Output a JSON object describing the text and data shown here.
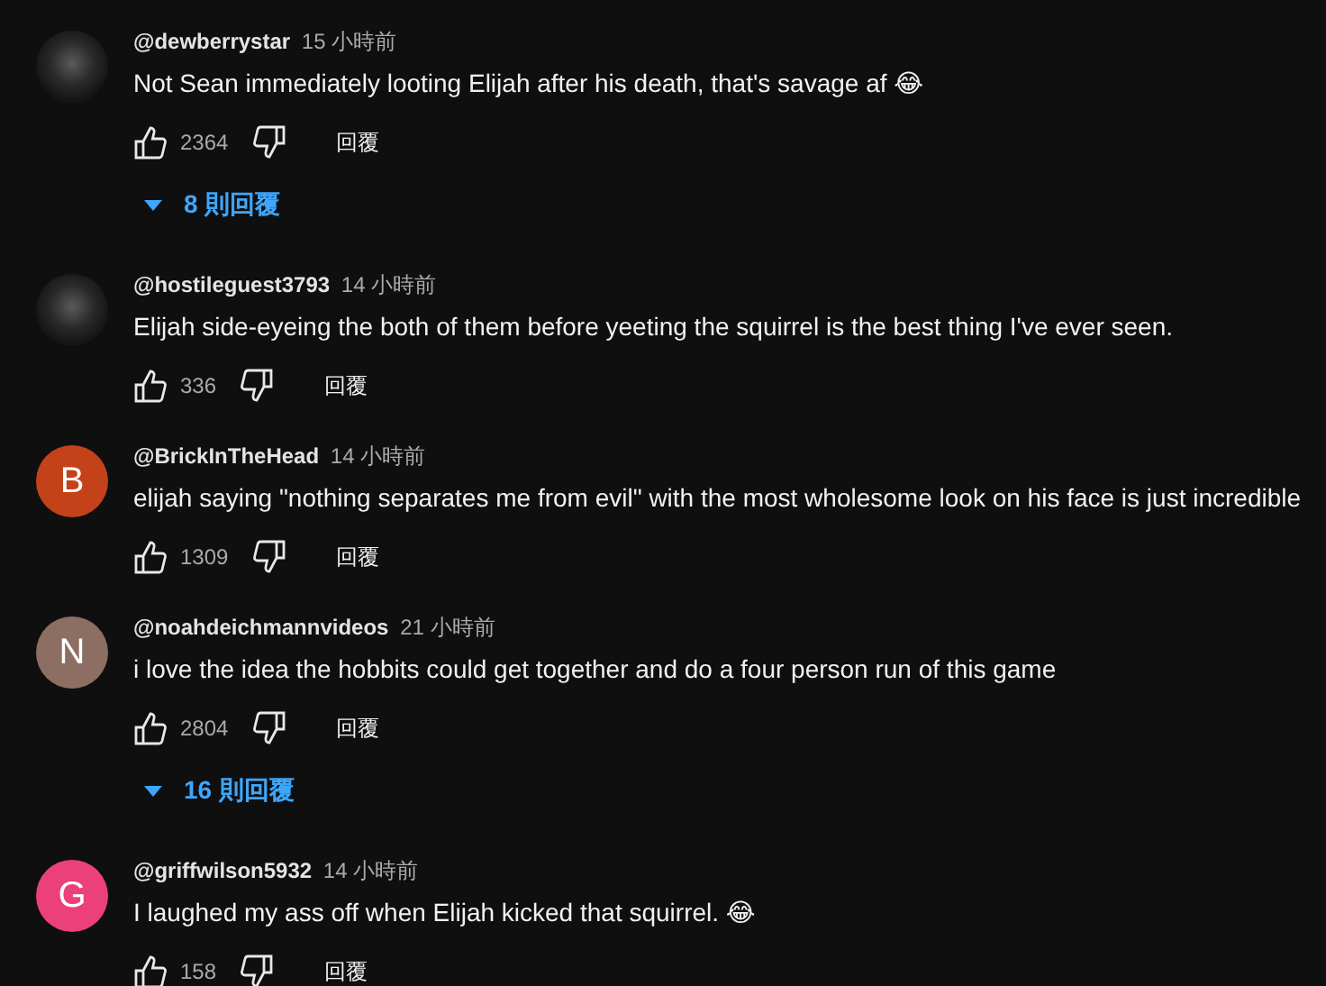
{
  "comments": [
    {
      "avatar": {
        "kind": "image"
      },
      "author": "@dewberrystar",
      "time": "15 小時前",
      "text": "Not Sean immediately looting Elijah after his death, that's savage af 😂",
      "likes": "2364",
      "reply_label": "回覆",
      "replies": "8 則回覆"
    },
    {
      "avatar": {
        "kind": "image"
      },
      "author": "@hostileguest3793",
      "time": "14 小時前",
      "text": "Elijah side-eyeing the both of them before yeeting the squirrel is the best thing I've ever seen.",
      "likes": "336",
      "reply_label": "回覆"
    },
    {
      "avatar": {
        "kind": "letter",
        "letter": "B",
        "color": "#c4421a"
      },
      "author": "@BrickInTheHead",
      "time": "14 小時前",
      "text": "elijah saying \"nothing separates me from evil\" with the most wholesome look on his face is just incredible",
      "likes": "1309",
      "reply_label": "回覆"
    },
    {
      "avatar": {
        "kind": "letter",
        "letter": "N",
        "color": "#8d6e63"
      },
      "author": "@noahdeichmannvideos",
      "time": "21 小時前",
      "text": "i love the idea the hobbits could get together and do a four person run of this game",
      "likes": "2804",
      "reply_label": "回覆",
      "replies": "16 則回覆"
    },
    {
      "avatar": {
        "kind": "letter",
        "letter": "G",
        "color": "#ec407a"
      },
      "author": "@griffwilson5932",
      "time": "14 小時前",
      "text": "I laughed my ass off when Elijah kicked that squirrel. 😂",
      "likes": "158",
      "reply_label": "回覆"
    }
  ]
}
